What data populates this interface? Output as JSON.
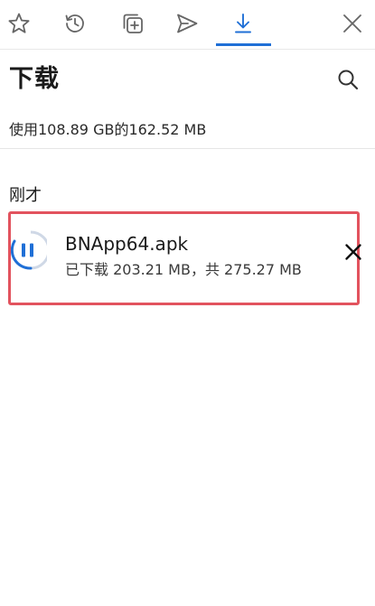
{
  "tabs": [
    {
      "id": "favorites",
      "icon": "star-icon"
    },
    {
      "id": "history",
      "icon": "history-icon"
    },
    {
      "id": "collections",
      "icon": "collections-icon"
    },
    {
      "id": "share",
      "icon": "send-icon"
    },
    {
      "id": "downloads",
      "icon": "download-icon",
      "active": true
    }
  ],
  "header": {
    "title": "下载",
    "search_icon": "search-icon",
    "close_icon": "close-icon"
  },
  "storage": {
    "text": "使用108.89 GB的162.52 MB"
  },
  "section": {
    "label": "刚才"
  },
  "download_item": {
    "file_name": "BNApp64.apk",
    "progress_text": "已下载 203.21 MB，共 275.27 MB",
    "state": "paused",
    "pause_icon": "pause-icon",
    "cancel_icon": "close-icon"
  },
  "colors": {
    "accent": "#1f6fd6",
    "highlight_border": "#e2535e",
    "icon_gray": "#666666"
  }
}
